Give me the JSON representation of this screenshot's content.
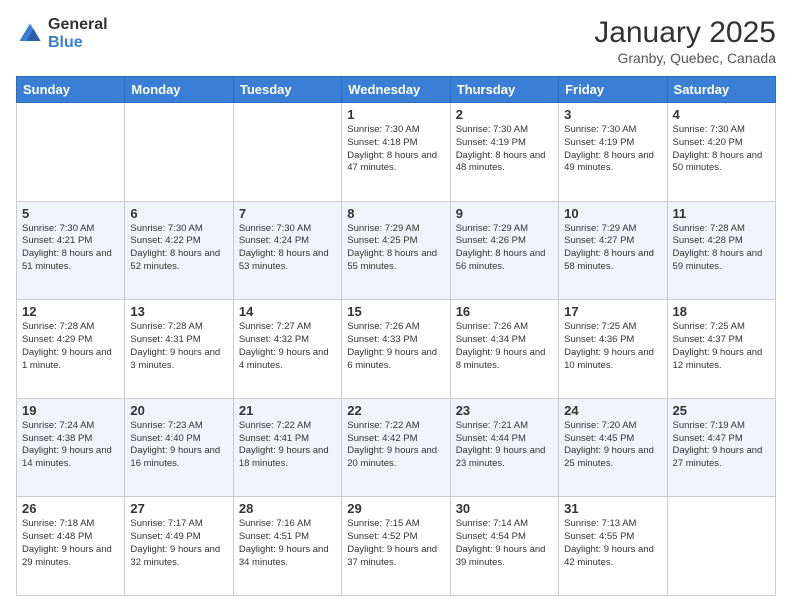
{
  "logo": {
    "general": "General",
    "blue": "Blue"
  },
  "header": {
    "title": "January 2025",
    "location": "Granby, Quebec, Canada"
  },
  "weekdays": [
    "Sunday",
    "Monday",
    "Tuesday",
    "Wednesday",
    "Thursday",
    "Friday",
    "Saturday"
  ],
  "weeks": [
    [
      {
        "day": "",
        "info": ""
      },
      {
        "day": "",
        "info": ""
      },
      {
        "day": "",
        "info": ""
      },
      {
        "day": "1",
        "info": "Sunrise: 7:30 AM\nSunset: 4:18 PM\nDaylight: 8 hours\nand 47 minutes."
      },
      {
        "day": "2",
        "info": "Sunrise: 7:30 AM\nSunset: 4:19 PM\nDaylight: 8 hours\nand 48 minutes."
      },
      {
        "day": "3",
        "info": "Sunrise: 7:30 AM\nSunset: 4:19 PM\nDaylight: 8 hours\nand 49 minutes."
      },
      {
        "day": "4",
        "info": "Sunrise: 7:30 AM\nSunset: 4:20 PM\nDaylight: 8 hours\nand 50 minutes."
      }
    ],
    [
      {
        "day": "5",
        "info": "Sunrise: 7:30 AM\nSunset: 4:21 PM\nDaylight: 8 hours\nand 51 minutes."
      },
      {
        "day": "6",
        "info": "Sunrise: 7:30 AM\nSunset: 4:22 PM\nDaylight: 8 hours\nand 52 minutes."
      },
      {
        "day": "7",
        "info": "Sunrise: 7:30 AM\nSunset: 4:24 PM\nDaylight: 8 hours\nand 53 minutes."
      },
      {
        "day": "8",
        "info": "Sunrise: 7:29 AM\nSunset: 4:25 PM\nDaylight: 8 hours\nand 55 minutes."
      },
      {
        "day": "9",
        "info": "Sunrise: 7:29 AM\nSunset: 4:26 PM\nDaylight: 8 hours\nand 56 minutes."
      },
      {
        "day": "10",
        "info": "Sunrise: 7:29 AM\nSunset: 4:27 PM\nDaylight: 8 hours\nand 58 minutes."
      },
      {
        "day": "11",
        "info": "Sunrise: 7:28 AM\nSunset: 4:28 PM\nDaylight: 8 hours\nand 59 minutes."
      }
    ],
    [
      {
        "day": "12",
        "info": "Sunrise: 7:28 AM\nSunset: 4:29 PM\nDaylight: 9 hours\nand 1 minute."
      },
      {
        "day": "13",
        "info": "Sunrise: 7:28 AM\nSunset: 4:31 PM\nDaylight: 9 hours\nand 3 minutes."
      },
      {
        "day": "14",
        "info": "Sunrise: 7:27 AM\nSunset: 4:32 PM\nDaylight: 9 hours\nand 4 minutes."
      },
      {
        "day": "15",
        "info": "Sunrise: 7:26 AM\nSunset: 4:33 PM\nDaylight: 9 hours\nand 6 minutes."
      },
      {
        "day": "16",
        "info": "Sunrise: 7:26 AM\nSunset: 4:34 PM\nDaylight: 9 hours\nand 8 minutes."
      },
      {
        "day": "17",
        "info": "Sunrise: 7:25 AM\nSunset: 4:36 PM\nDaylight: 9 hours\nand 10 minutes."
      },
      {
        "day": "18",
        "info": "Sunrise: 7:25 AM\nSunset: 4:37 PM\nDaylight: 9 hours\nand 12 minutes."
      }
    ],
    [
      {
        "day": "19",
        "info": "Sunrise: 7:24 AM\nSunset: 4:38 PM\nDaylight: 9 hours\nand 14 minutes."
      },
      {
        "day": "20",
        "info": "Sunrise: 7:23 AM\nSunset: 4:40 PM\nDaylight: 9 hours\nand 16 minutes."
      },
      {
        "day": "21",
        "info": "Sunrise: 7:22 AM\nSunset: 4:41 PM\nDaylight: 9 hours\nand 18 minutes."
      },
      {
        "day": "22",
        "info": "Sunrise: 7:22 AM\nSunset: 4:42 PM\nDaylight: 9 hours\nand 20 minutes."
      },
      {
        "day": "23",
        "info": "Sunrise: 7:21 AM\nSunset: 4:44 PM\nDaylight: 9 hours\nand 23 minutes."
      },
      {
        "day": "24",
        "info": "Sunrise: 7:20 AM\nSunset: 4:45 PM\nDaylight: 9 hours\nand 25 minutes."
      },
      {
        "day": "25",
        "info": "Sunrise: 7:19 AM\nSunset: 4:47 PM\nDaylight: 9 hours\nand 27 minutes."
      }
    ],
    [
      {
        "day": "26",
        "info": "Sunrise: 7:18 AM\nSunset: 4:48 PM\nDaylight: 9 hours\nand 29 minutes."
      },
      {
        "day": "27",
        "info": "Sunrise: 7:17 AM\nSunset: 4:49 PM\nDaylight: 9 hours\nand 32 minutes."
      },
      {
        "day": "28",
        "info": "Sunrise: 7:16 AM\nSunset: 4:51 PM\nDaylight: 9 hours\nand 34 minutes."
      },
      {
        "day": "29",
        "info": "Sunrise: 7:15 AM\nSunset: 4:52 PM\nDaylight: 9 hours\nand 37 minutes."
      },
      {
        "day": "30",
        "info": "Sunrise: 7:14 AM\nSunset: 4:54 PM\nDaylight: 9 hours\nand 39 minutes."
      },
      {
        "day": "31",
        "info": "Sunrise: 7:13 AM\nSunset: 4:55 PM\nDaylight: 9 hours\nand 42 minutes."
      },
      {
        "day": "",
        "info": ""
      }
    ]
  ]
}
